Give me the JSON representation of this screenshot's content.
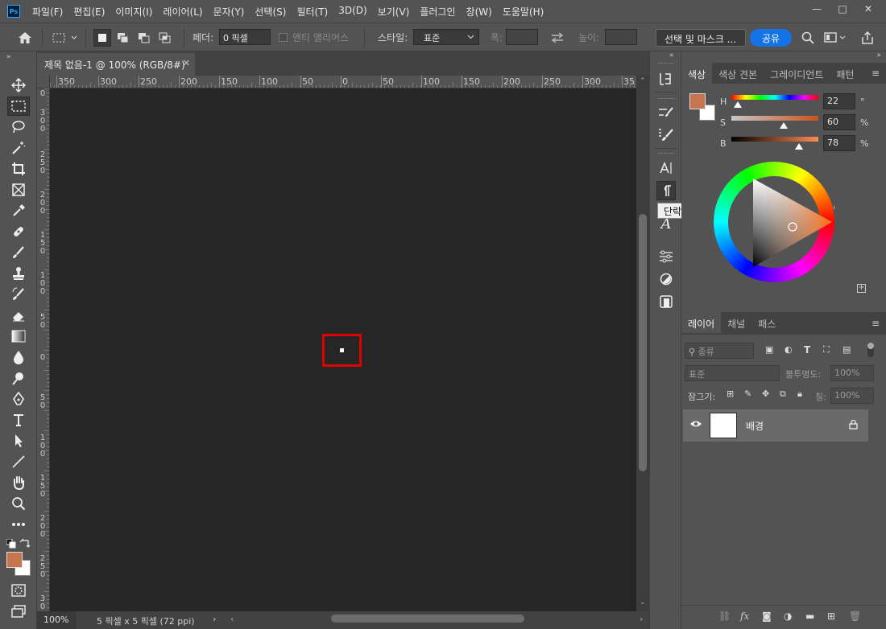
{
  "app": {
    "logo_text": "Ps"
  },
  "menu": [
    "파일(F)",
    "편집(E)",
    "이미지(I)",
    "레이어(L)",
    "문자(Y)",
    "선택(S)",
    "필터(T)",
    "3D(D)",
    "보기(V)",
    "플러그인",
    "창(W)",
    "도움말(H)"
  ],
  "window_controls": {
    "minimize": "—",
    "maximize": "□",
    "close": "✕"
  },
  "options": {
    "feather_label": "페더:",
    "feather_value": "0 픽셀",
    "antialias_label": "앤티 앨리어스",
    "style_label": "스타일:",
    "style_value": "표준",
    "width_label": "폭:",
    "height_label": "높이:",
    "select_mask_button": "선택 및 마스크 ...",
    "share_button": "공유"
  },
  "document": {
    "tab_title": "제목 없음-1 @ 100% (RGB/8#)",
    "zoom": "100%",
    "status": "5 픽셀 x 5 픽셀 (72 ppi)"
  },
  "ruler": {
    "h_labels": [
      "350",
      "300",
      "250",
      "200",
      "150",
      "100",
      "50",
      "0",
      "50",
      "100",
      "150",
      "200",
      "250",
      "300",
      "35"
    ],
    "v_labels": [
      "0",
      "3 0 0",
      "2 5 0",
      "2 0 0",
      "1 5 0",
      "1 0 0",
      "5 0",
      "0",
      "5 0",
      "1 0 0",
      "1 5 0",
      "2 0 0",
      "2 5 0",
      "3 0 0"
    ]
  },
  "tooltip": "단락",
  "color_panel": {
    "tabs": [
      "색상",
      "색상 견본",
      "그레이디언트",
      "패턴"
    ],
    "h_label": "H",
    "h_value": "22",
    "h_unit": "°",
    "s_label": "S",
    "s_value": "60",
    "s_unit": "%",
    "b_label": "B",
    "b_value": "78",
    "b_unit": "%",
    "foreground_color": "#c7754f",
    "background_color": "#ffffff"
  },
  "layers_panel": {
    "tabs": [
      "레이어",
      "채널",
      "패스"
    ],
    "filter_label": "종류",
    "blend_mode": "표준",
    "opacity_label": "불투명도:",
    "opacity_value": "100%",
    "lock_label": "잠그기:",
    "fill_label": "칠:",
    "fill_value": "100%",
    "layers": [
      {
        "name": "배경"
      }
    ]
  }
}
